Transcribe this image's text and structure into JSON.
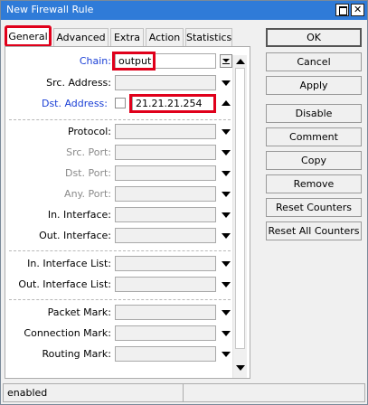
{
  "window": {
    "title": "New Firewall Rule"
  },
  "tabs": [
    {
      "label": "General",
      "active": true
    },
    {
      "label": "Advanced"
    },
    {
      "label": "Extra"
    },
    {
      "label": "Action"
    },
    {
      "label": "Statistics"
    }
  ],
  "form": {
    "chain": {
      "label": "Chain:",
      "value": "output"
    },
    "src_address": {
      "label": "Src. Address:",
      "value": ""
    },
    "dst_address": {
      "label": "Dst. Address:",
      "value": "21.21.21.254"
    },
    "protocol": {
      "label": "Protocol:",
      "value": ""
    },
    "src_port": {
      "label": "Src. Port:",
      "value": ""
    },
    "dst_port": {
      "label": "Dst. Port:",
      "value": ""
    },
    "any_port": {
      "label": "Any. Port:",
      "value": ""
    },
    "in_interface": {
      "label": "In. Interface:",
      "value": ""
    },
    "out_interface": {
      "label": "Out. Interface:",
      "value": ""
    },
    "in_interface_list": {
      "label": "In. Interface List:",
      "value": ""
    },
    "out_interface_list": {
      "label": "Out. Interface List:",
      "value": ""
    },
    "packet_mark": {
      "label": "Packet Mark:",
      "value": ""
    },
    "connection_mark": {
      "label": "Connection Mark:",
      "value": ""
    },
    "routing_mark": {
      "label": "Routing Mark:",
      "value": ""
    }
  },
  "buttons": {
    "ok": "OK",
    "cancel": "Cancel",
    "apply": "Apply",
    "disable": "Disable",
    "comment": "Comment",
    "copy": "Copy",
    "remove": "Remove",
    "reset_counters": "Reset Counters",
    "reset_all_counters": "Reset All Counters"
  },
  "status": {
    "text": "enabled"
  },
  "colors": {
    "titlebar": "#2f7bd8",
    "highlight": "#e0001b",
    "link_label": "#1a3fd6"
  }
}
